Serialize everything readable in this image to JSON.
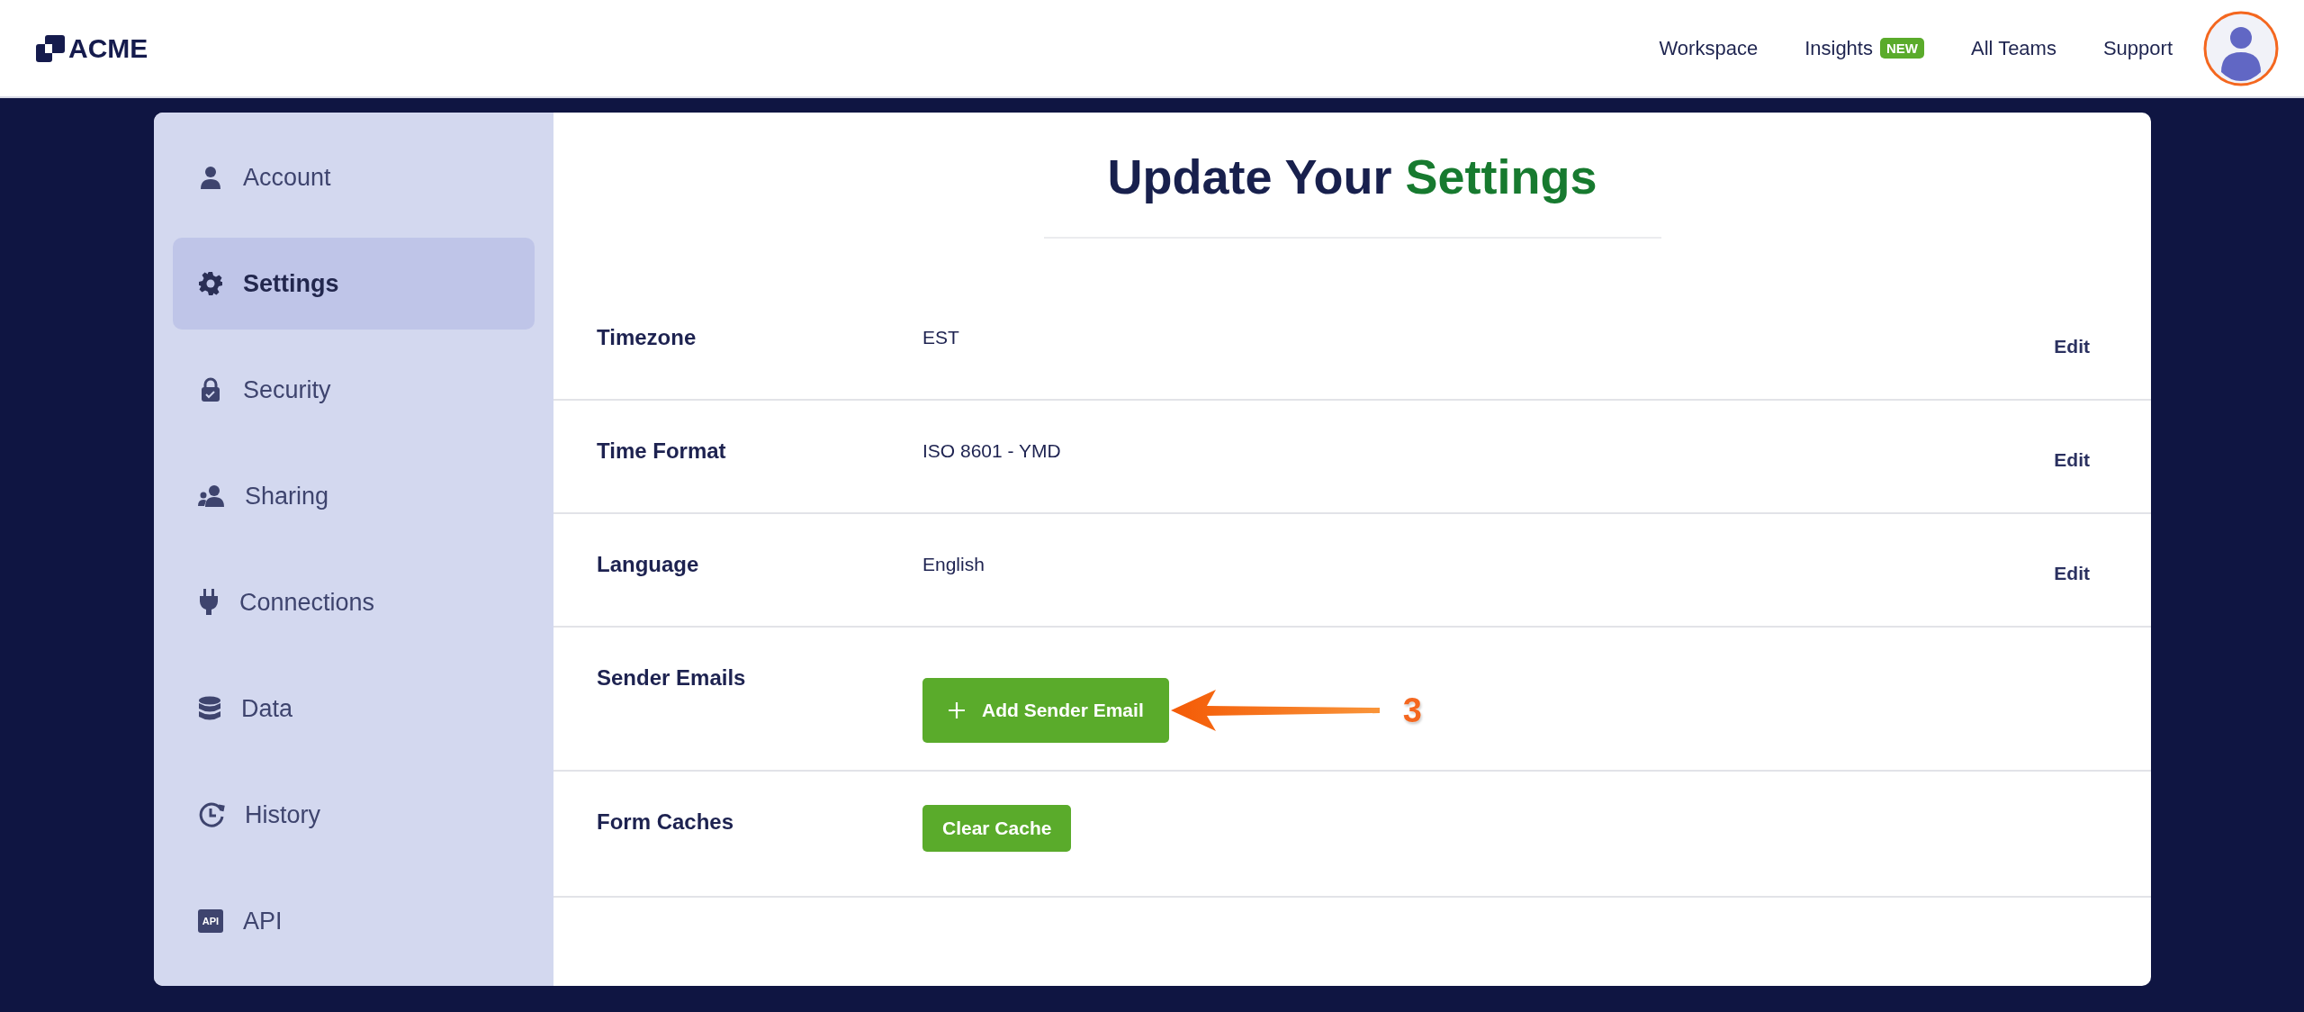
{
  "header": {
    "logo": "ACME",
    "nav": [
      {
        "label": "Workspace"
      },
      {
        "label": "Insights",
        "badge": "NEW"
      },
      {
        "label": "All Teams"
      },
      {
        "label": "Support"
      }
    ]
  },
  "sidebar": {
    "items": [
      {
        "label": "Account",
        "selected": false
      },
      {
        "label": "Settings",
        "selected": true
      },
      {
        "label": "Security",
        "selected": false
      },
      {
        "label": "Sharing",
        "selected": false
      },
      {
        "label": "Connections",
        "selected": false
      },
      {
        "label": "Data",
        "selected": false
      },
      {
        "label": "History",
        "selected": false
      },
      {
        "label": "API",
        "icon_text": "API",
        "selected": false
      }
    ]
  },
  "main": {
    "title": "Update Your **Settings**",
    "rows": [
      {
        "kind": "value",
        "label": "Timezone",
        "value": "EST",
        "action": "Edit"
      },
      {
        "kind": "value",
        "label": "Time Format",
        "value": "ISO 8601 - YMD",
        "action": "Edit"
      },
      {
        "kind": "value",
        "label": "Language",
        "value": "English",
        "action": "Edit"
      },
      {
        "kind": "add_button",
        "label": "Sender Emails",
        "button": "Add Sender Email",
        "annotation": "3"
      },
      {
        "kind": "button",
        "label": "Form Caches",
        "button": "Clear Cache"
      }
    ]
  }
}
